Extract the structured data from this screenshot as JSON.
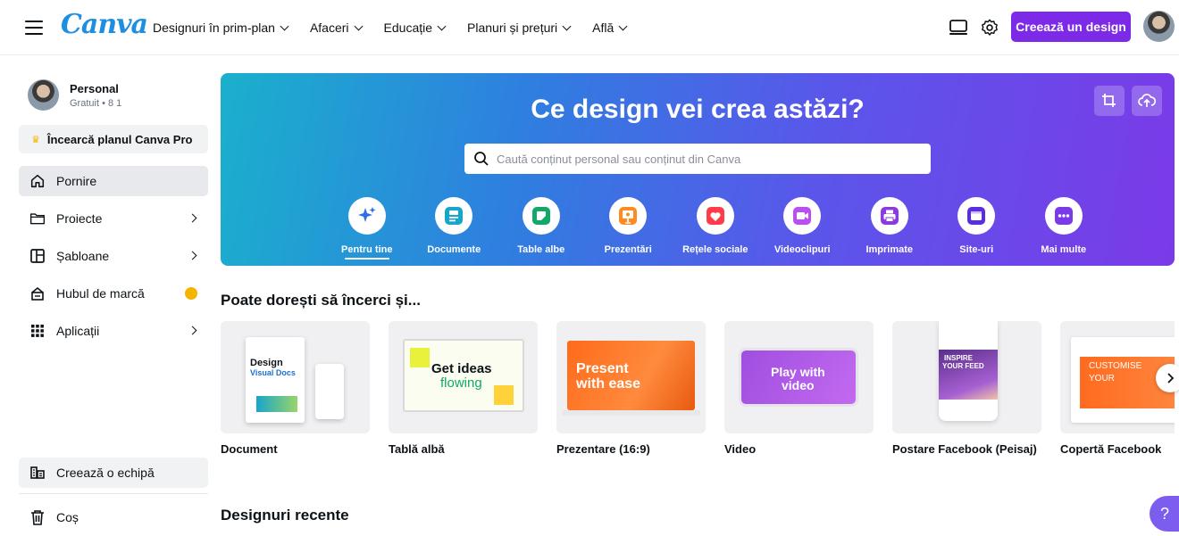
{
  "app": {
    "logo": "Canva",
    "nav": [
      {
        "label": "Designuri în prim-plan"
      },
      {
        "label": "Afaceri"
      },
      {
        "label": "Educație"
      },
      {
        "label": "Planuri și prețuri"
      },
      {
        "label": "Află"
      }
    ],
    "create_label": "Creează un design"
  },
  "sidebar": {
    "profile_name": "Personal",
    "profile_plan": "Gratuit • 8 1",
    "pro_label": "Încearcă planul Canva Pro",
    "items": [
      {
        "label": "Pornire",
        "icon": "home-icon"
      },
      {
        "label": "Proiecte",
        "icon": "folder-icon"
      },
      {
        "label": "Șabloane",
        "icon": "template-icon"
      },
      {
        "label": "Hubul de marcă",
        "icon": "brand-icon"
      },
      {
        "label": "Aplicații",
        "icon": "apps-grid-icon"
      }
    ],
    "team_label": "Creează o echipă",
    "trash_label": "Coș"
  },
  "hero": {
    "title": "Ce design vei crea astăzi?",
    "search_placeholder": "Caută conținut personal sau conținut din Canva",
    "categories": [
      {
        "label": "Pentru tine",
        "icon": "sparkle-icon",
        "color": "#2f6de8"
      },
      {
        "label": "Documente",
        "icon": "document-icon",
        "color": "#17a6c9"
      },
      {
        "label": "Table albe",
        "icon": "whiteboard-icon",
        "color": "#13a86a"
      },
      {
        "label": "Prezentări",
        "icon": "presentation-icon",
        "color": "#ff8a1f"
      },
      {
        "label": "Rețele sociale",
        "icon": "heart-icon",
        "color": "#ff3d4a"
      },
      {
        "label": "Videoclipuri",
        "icon": "video-icon",
        "color": "#b84ff0"
      },
      {
        "label": "Imprimate",
        "icon": "print-icon",
        "color": "#8b3ae0"
      },
      {
        "label": "Site-uri",
        "icon": "website-icon",
        "color": "#5a2ee0"
      },
      {
        "label": "Mai multe",
        "icon": "more-icon",
        "color": "#7b3ae8"
      }
    ]
  },
  "suggestions": {
    "title": "Poate dorești să încerci și...",
    "cards": [
      {
        "label": "Document",
        "art_line1": "Design",
        "art_line2": "Visual Docs"
      },
      {
        "label": "Tablă albă",
        "art_line1": "Get ideas",
        "art_line2": "flowing"
      },
      {
        "label": "Prezentare (16:9)",
        "art_line1": "Present",
        "art_line2": "with ease"
      },
      {
        "label": "Video",
        "art_line1": "Play with",
        "art_line2": "video"
      },
      {
        "label": "Postare Facebook (Peisaj)",
        "art_line1": "INSPIRE",
        "art_line2": "YOUR FEED"
      },
      {
        "label": "Copertă Facebook",
        "art_line1": "CUSTOMISE",
        "art_line2": "YOUR"
      }
    ]
  },
  "recent": {
    "title": "Designuri recente"
  },
  "help_label": "?"
}
